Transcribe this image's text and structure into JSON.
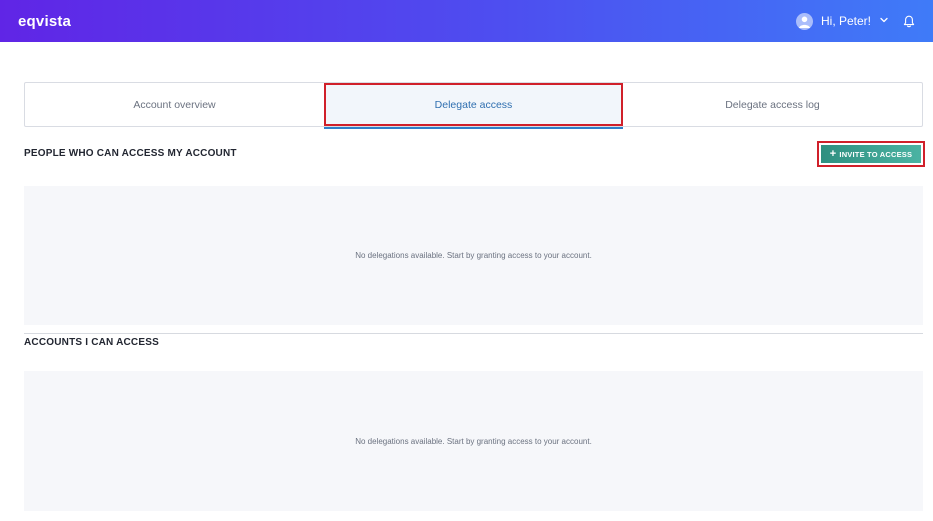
{
  "app": {
    "logo_text": "eqvista"
  },
  "header": {
    "greeting": "Hi, Peter!"
  },
  "tabs": [
    {
      "label": "Account overview",
      "active": false
    },
    {
      "label": "Delegate access",
      "active": true
    },
    {
      "label": "Delegate access log",
      "active": false
    }
  ],
  "sections": {
    "people": {
      "title": "PEOPLE WHO CAN ACCESS MY ACCOUNT",
      "button_label": "INVITE TO ACCESS",
      "empty_message": "No delegations available. Start by granting access to your account."
    },
    "accounts": {
      "title": "ACCOUNTS I CAN ACCESS",
      "empty_message": "No delegations available. Start by granting access to your account."
    }
  },
  "icons": {
    "user": "user-avatar-icon",
    "chevron": "chevron-down-icon",
    "bell": "bell-icon",
    "plus": "plus-icon"
  },
  "colors": {
    "header_gradient_start": "#6025e6",
    "header_gradient_end": "#3f7bf8",
    "active_tab_text": "#2f6fb0",
    "highlight_border": "#d0202a",
    "button_start": "#2f8f80",
    "button_end": "#4bb3a3",
    "panel_bg": "#f6f7fa"
  }
}
